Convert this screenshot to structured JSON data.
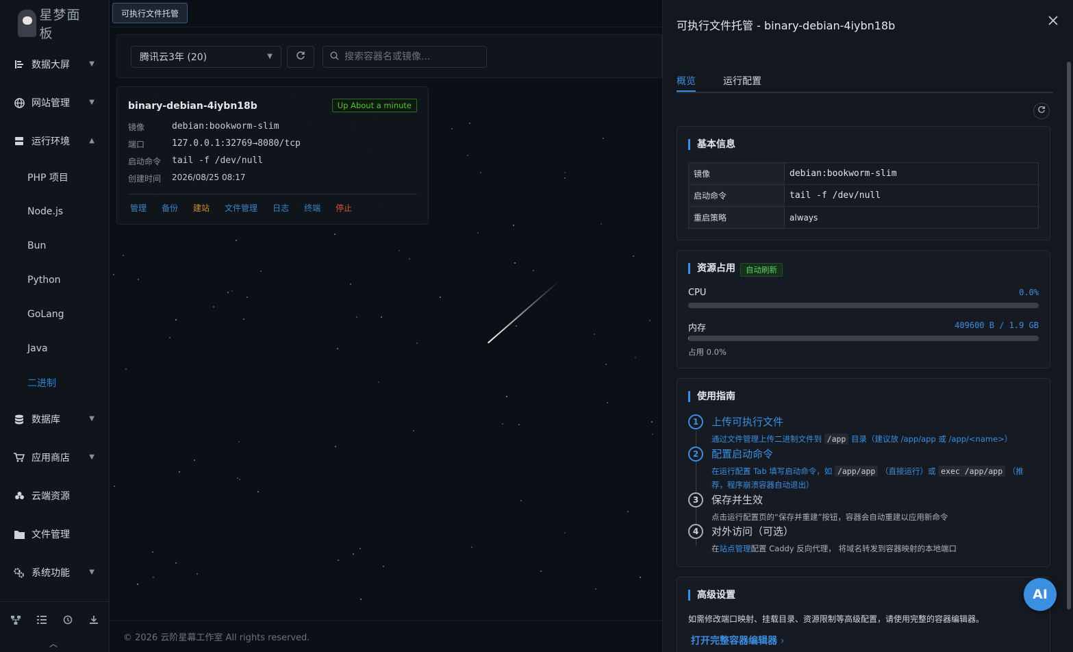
{
  "brand": {
    "logo_text": "星梦面板"
  },
  "sidebar": {
    "items": [
      {
        "label": "数据大屏",
        "icon": "chart-icon",
        "expanded": false
      },
      {
        "label": "网站管理",
        "icon": "globe-icon",
        "expanded": false
      },
      {
        "label": "运行环境",
        "icon": "server-icon",
        "expanded": true
      }
    ],
    "sub_items": [
      "PHP 项目",
      "Node.js",
      "Bun",
      "Python",
      "GoLang",
      "Java",
      "二进制"
    ],
    "active_sub": "二进制",
    "items_after": [
      {
        "label": "数据库",
        "icon": "database-icon"
      },
      {
        "label": "应用商店",
        "icon": "cart-icon"
      },
      {
        "label": "云端资源",
        "icon": "cloud-icon"
      },
      {
        "label": "文件管理",
        "icon": "folder-icon"
      },
      {
        "label": "系统功能",
        "icon": "gears-icon"
      }
    ],
    "footer_icons": [
      "sitemap-icon",
      "tasks-icon",
      "history-icon",
      "download-icon"
    ]
  },
  "main": {
    "top_tab": "可执行文件托管",
    "server_select": "腾讯云3年 (20)",
    "search_placeholder": "搜索容器名或镜像...",
    "card": {
      "name": "binary-debian-4iybn18b",
      "status": "Up About a minute",
      "rows": [
        {
          "k": "镜像",
          "v": "debian:bookworm-slim"
        },
        {
          "k": "端口",
          "v": "127.0.0.1:32769→8080/tcp"
        },
        {
          "k": "启动命令",
          "v": "tail -f /dev/null"
        },
        {
          "k": "创建时间",
          "v": "2026/08/25 08:17"
        }
      ],
      "actions": [
        "管理",
        "备份",
        "建站",
        "文件管理",
        "日志",
        "终端",
        "停止"
      ]
    },
    "copyright": "© 2026 云阶星幕工作室 All rights reserved."
  },
  "drawer": {
    "title": "可执行文件托管 - binary-debian-4iybn18b",
    "tabs": [
      "概览",
      "运行配置"
    ],
    "basic": {
      "title": "基本信息",
      "rows": [
        {
          "k": "镜像",
          "v": "debian:bookworm-slim"
        },
        {
          "k": "启动命令",
          "v": "tail -f /dev/null"
        },
        {
          "k": "重启策略",
          "v": "always"
        }
      ]
    },
    "resources": {
      "title": "资源占用",
      "tag": "自动刷新",
      "cpu_label": "CPU",
      "cpu_value": "0.0%",
      "cpu_fraction": 0.0,
      "mem_label": "内存",
      "mem_value": "409600 B / 1.9 GB",
      "mem_fraction": 0.002,
      "mem_note": "占用 0.0%"
    },
    "guide": {
      "title": "使用指南",
      "steps": [
        {
          "num": "1",
          "title": "上传可执行文件"
        },
        {
          "num": "2",
          "title": "配置启动命令"
        },
        {
          "num": "3",
          "title": "保存并生效",
          "desc": "点击运行配置页的“保存并重建”按钮，容器会自动重建以应用新命令"
        },
        {
          "num": "4",
          "title": "对外访问（可选）"
        }
      ],
      "s1": {
        "a": "通过文件管理上传二进制文件到",
        "code": "/app",
        "b": "目录（建议放 /app/app 或 /app/<name>）"
      },
      "s2": {
        "a": "在运行配置 Tab 填写启动命令，如",
        "code1": "/app/app",
        "b": "（直接运行）或",
        "code2": "exec /app/app",
        "c": "（推荐，程序崩溃容器自动退出）"
      },
      "s4": {
        "a": "在",
        "link": "站点管理",
        "b": "配置 Caddy 反向代理， 将域名转发到容器映射的本地端口"
      }
    },
    "advanced": {
      "title": "高级设置",
      "text": "如需修改端口映射、挂载目录、资源限制等高级配置，请使用完整的容器编辑器。",
      "link": "打开完整容器编辑器"
    },
    "ai_button": "AI"
  }
}
